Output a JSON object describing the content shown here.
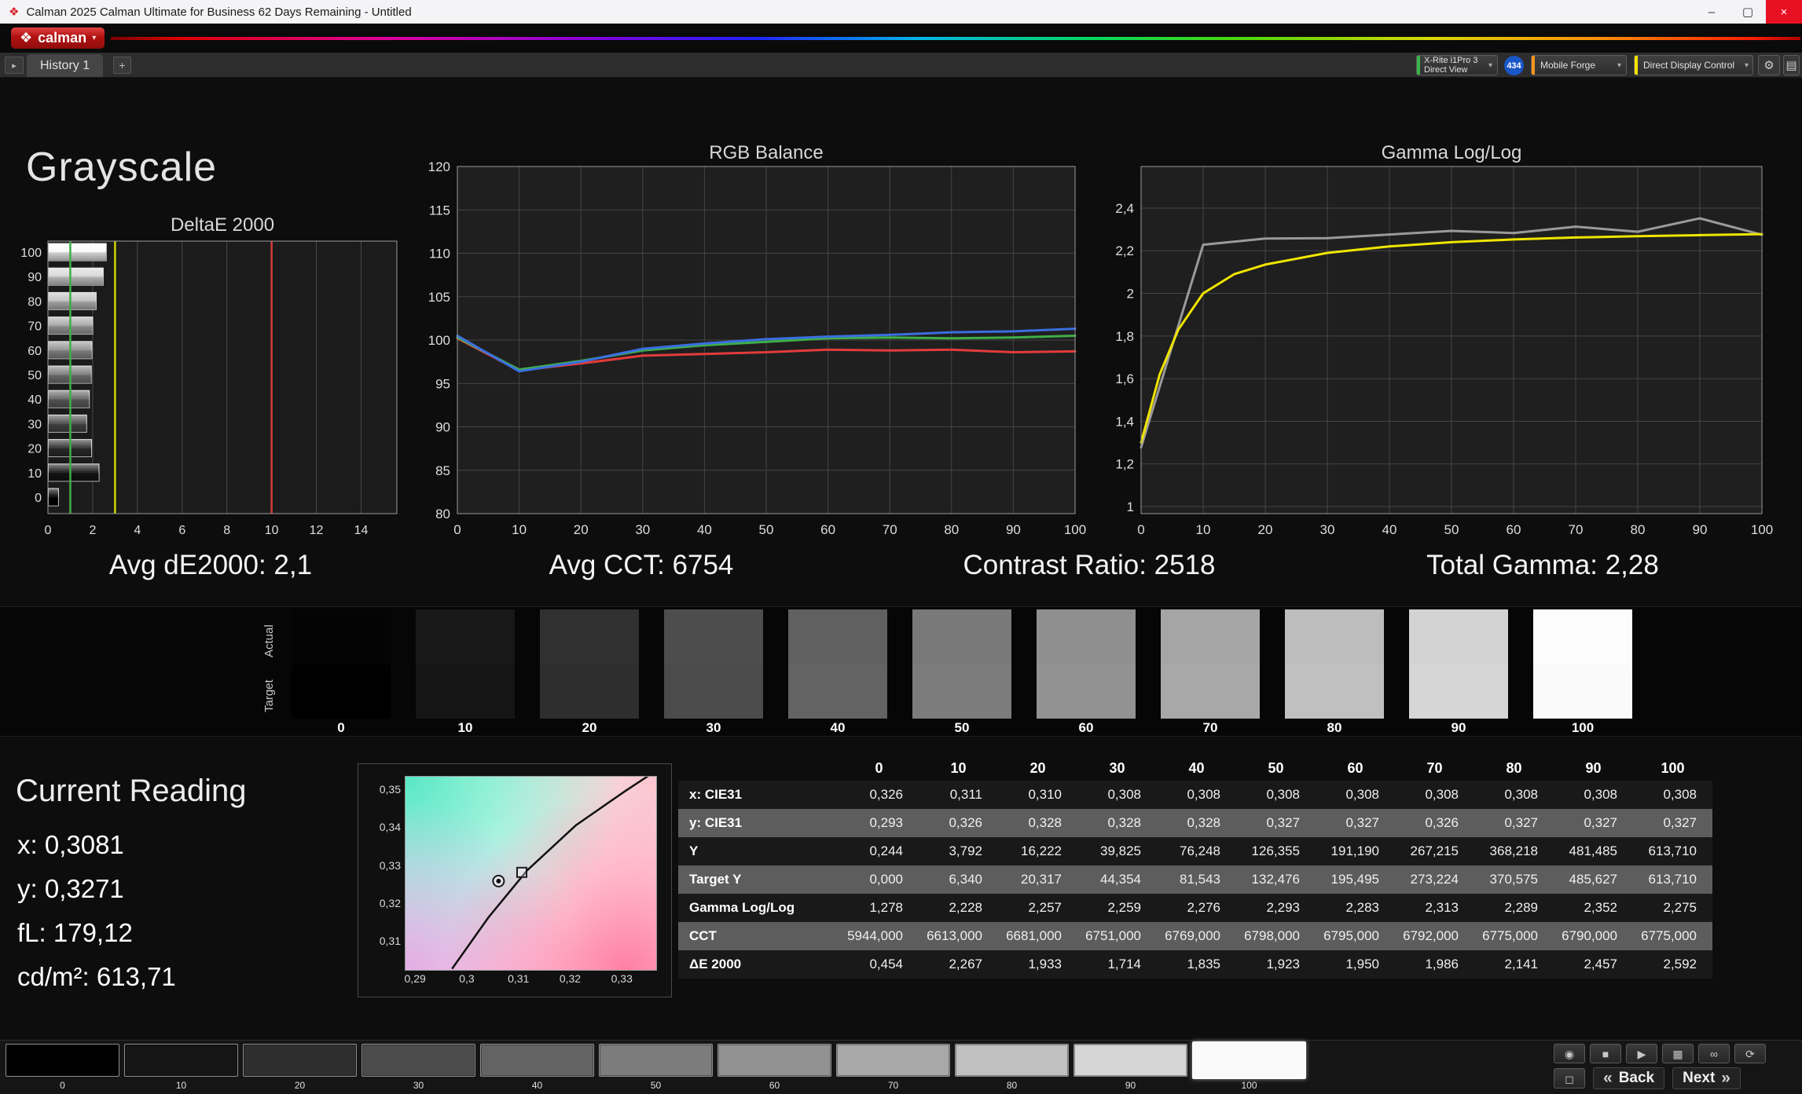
{
  "window": {
    "title": "Calman 2025 Calman Ultimate for Business 62 Days Remaining  - Untitled",
    "app_icon": "❖",
    "minimize_glyph": "–",
    "maximize_glyph": "▢",
    "close_glyph": "×",
    "logo_icon": "❖",
    "logo_text": "calman",
    "logo_caret": "▾"
  },
  "tabbar": {
    "expander_glyph": "▸",
    "history_tab": "History 1",
    "add_glyph": "+"
  },
  "toolbar": {
    "meter_button": {
      "line1": "X-Rite i1Pro 3",
      "line2": "Direct View",
      "accent": "#3cb54a",
      "caret": "▾"
    },
    "badge": "434",
    "badge_color": "#1956c8",
    "source_button": {
      "label": "Mobile Forge",
      "accent": "#f7941d",
      "caret": "▾"
    },
    "display_button": {
      "label": "Direct Display Control",
      "accent": "#f5e400",
      "caret": "▾"
    },
    "gear_glyph": "⚙",
    "panel_glyph": "▤"
  },
  "page": {
    "title": "Grayscale",
    "summaries": [
      "Avg dE2000: 2,1",
      "Avg CCT: 6754",
      "Contrast Ratio: 2518",
      "Total Gamma: 2,28"
    ]
  },
  "chart_data": [
    {
      "type": "bar",
      "title": "DeltaE 2000",
      "orientation": "horizontal",
      "categories": [
        100,
        90,
        80,
        70,
        60,
        50,
        40,
        30,
        20,
        10,
        0
      ],
      "values": [
        2.592,
        2.457,
        2.141,
        1.986,
        1.95,
        1.923,
        1.835,
        1.714,
        1.933,
        2.267,
        0.454
      ],
      "xlim": [
        0,
        15.6
      ],
      "xticks": [
        0,
        2,
        4,
        6,
        8,
        10,
        12,
        14
      ],
      "reference_lines": [
        {
          "name": "good",
          "value": 1,
          "color": "#3fae49"
        },
        {
          "name": "warning",
          "value": 3,
          "color": "#cfd400"
        },
        {
          "name": "bad",
          "value": 10,
          "color": "#d43a3a"
        }
      ]
    },
    {
      "type": "line",
      "title": "RGB Balance",
      "x": [
        0,
        10,
        20,
        30,
        40,
        50,
        60,
        70,
        80,
        90,
        100
      ],
      "ylim": [
        80,
        120
      ],
      "yticks": [
        120,
        115,
        110,
        105,
        100,
        95,
        90,
        85,
        80
      ],
      "xticks": [
        0,
        10,
        20,
        30,
        40,
        50,
        60,
        70,
        80,
        90,
        100
      ],
      "series": [
        {
          "name": "Red",
          "color": "#e23b3b",
          "values": [
            100.2,
            96.5,
            97.3,
            98.2,
            98.4,
            98.6,
            98.9,
            98.8,
            98.9,
            98.6,
            98.7
          ]
        },
        {
          "name": "Green",
          "color": "#3fae49",
          "values": [
            100.3,
            96.6,
            97.6,
            98.8,
            99.4,
            99.8,
            100.2,
            100.3,
            100.2,
            100.3,
            100.5
          ]
        },
        {
          "name": "Blue",
          "color": "#3a6fe0",
          "values": [
            100.5,
            96.4,
            97.5,
            99.0,
            99.6,
            100.1,
            100.4,
            100.6,
            100.9,
            101.0,
            101.3
          ]
        }
      ]
    },
    {
      "type": "line",
      "title": "Gamma Log/Log",
      "ylim": [
        0.967,
        2.595
      ],
      "yticks": [
        {
          "v": 2.4,
          "label": "2,4"
        },
        {
          "v": 2.2,
          "label": "2,2"
        },
        {
          "v": 2.0,
          "label": "2"
        },
        {
          "v": 1.8,
          "label": "1,8"
        },
        {
          "v": 1.6,
          "label": "1,6"
        },
        {
          "v": 1.4,
          "label": "1,4"
        },
        {
          "v": 1.2,
          "label": "1,2"
        },
        {
          "v": 1.0,
          "label": "1"
        }
      ],
      "xticks": [
        0,
        10,
        20,
        30,
        40,
        50,
        60,
        70,
        80,
        90,
        100
      ],
      "series": [
        {
          "name": "Measured",
          "color": "#9a9a9a",
          "x": [
            0,
            10,
            20,
            30,
            40,
            50,
            60,
            70,
            80,
            90,
            100
          ],
          "values": [
            1.278,
            2.228,
            2.257,
            2.259,
            2.276,
            2.293,
            2.283,
            2.313,
            2.289,
            2.352,
            2.275
          ]
        },
        {
          "name": "Gamma trend",
          "color": "#f0e500",
          "x": [
            0,
            3,
            6,
            10,
            15,
            20,
            30,
            40,
            50,
            60,
            70,
            80,
            90,
            100
          ],
          "values": [
            1.3,
            1.62,
            1.83,
            2.0,
            2.09,
            2.135,
            2.19,
            2.22,
            2.24,
            2.253,
            2.262,
            2.268,
            2.273,
            2.278
          ]
        }
      ]
    }
  ],
  "swatches": {
    "row_labels": [
      "Actual",
      "Target"
    ],
    "levels": [
      "0",
      "10",
      "20",
      "30",
      "40",
      "50",
      "60",
      "70",
      "80",
      "90",
      "100"
    ],
    "actual_colors": [
      "#040404",
      "#181818",
      "#303030",
      "#4d4d4d",
      "#606060",
      "#797979",
      "#8f8f8f",
      "#a5a5a5",
      "#bdbdbd",
      "#d3d3d3",
      "#fcfcfc"
    ],
    "target_colors": [
      "#000000",
      "#151515",
      "#2e2e2e",
      "#4b4b4b",
      "#636363",
      "#7c7c7c",
      "#929292",
      "#a8a8a8",
      "#c0c0c0",
      "#d6d6d6",
      "#fafafa"
    ]
  },
  "current_reading": {
    "title": "Current Reading",
    "values": [
      "x: 0,3081",
      "y: 0,3271",
      "fL: 179,12",
      "cd/m²: 613,71"
    ]
  },
  "cie_chart": {
    "xticks": [
      "0,29",
      "0,3",
      "0,31",
      "0,32",
      "0,33"
    ],
    "xtick_values": [
      0.29,
      0.3,
      0.31,
      0.32,
      0.33
    ],
    "yticks": [
      "0,35",
      "0,34",
      "0,33",
      "0,32",
      "0,31"
    ],
    "ytick_values": [
      0.35,
      0.34,
      0.33,
      0.32,
      0.31
    ],
    "xlim": [
      0.288,
      0.3365
    ],
    "ylim": [
      0.3027,
      0.3538
    ],
    "locus": [
      [
        0.297,
        0.303
      ],
      [
        0.304,
        0.3165
      ],
      [
        0.3115,
        0.329
      ],
      [
        0.321,
        0.341
      ],
      [
        0.3305,
        0.35
      ],
      [
        0.3355,
        0.3545
      ]
    ],
    "markers": [
      {
        "shape": "circle",
        "x": 0.306,
        "y": 0.3262
      },
      {
        "shape": "square",
        "x": 0.3105,
        "y": 0.3285
      }
    ]
  },
  "table": {
    "columns": [
      "0",
      "10",
      "20",
      "30",
      "40",
      "50",
      "60",
      "70",
      "80",
      "90",
      "100"
    ],
    "rows": [
      {
        "label": "x: CIE31",
        "shade": "dark",
        "values": [
          "0,326",
          "0,311",
          "0,310",
          "0,308",
          "0,308",
          "0,308",
          "0,308",
          "0,308",
          "0,308",
          "0,308",
          "0,308"
        ]
      },
      {
        "label": "y: CIE31",
        "shade": "light",
        "values": [
          "0,293",
          "0,326",
          "0,328",
          "0,328",
          "0,328",
          "0,327",
          "0,327",
          "0,326",
          "0,327",
          "0,327",
          "0,327"
        ]
      },
      {
        "label": "Y",
        "shade": "dark",
        "values": [
          "0,244",
          "3,792",
          "16,222",
          "39,825",
          "76,248",
          "126,355",
          "191,190",
          "267,215",
          "368,218",
          "481,485",
          "613,710"
        ]
      },
      {
        "label": "Target Y",
        "shade": "light",
        "values": [
          "0,000",
          "6,340",
          "20,317",
          "44,354",
          "81,543",
          "132,476",
          "195,495",
          "273,224",
          "370,575",
          "485,627",
          "613,710"
        ]
      },
      {
        "label": "Gamma Log/Log",
        "shade": "dark",
        "values": [
          "1,278",
          "2,228",
          "2,257",
          "2,259",
          "2,276",
          "2,293",
          "2,283",
          "2,313",
          "2,289",
          "2,352",
          "2,275"
        ]
      },
      {
        "label": "CCT",
        "shade": "light",
        "values": [
          "5944,000",
          "6613,000",
          "6681,000",
          "6751,000",
          "6769,000",
          "6798,000",
          "6795,000",
          "6792,000",
          "6775,000",
          "6790,000",
          "6775,000"
        ]
      },
      {
        "label": "ΔE 2000",
        "shade": "dark",
        "values": [
          "0,454",
          "2,267",
          "1,933",
          "1,714",
          "1,835",
          "1,923",
          "1,950",
          "1,986",
          "2,141",
          "2,457",
          "2,592"
        ]
      }
    ]
  },
  "bottom_bar": {
    "levels": [
      "0",
      "10",
      "20",
      "30",
      "40",
      "50",
      "60",
      "70",
      "80",
      "90",
      "100"
    ],
    "colors": [
      "#000000",
      "#151515",
      "#2e2e2e",
      "#4b4b4b",
      "#636363",
      "#7c7c7c",
      "#929292",
      "#a8a8a8",
      "#c0c0c0",
      "#d6d6d6",
      "#fafafa"
    ],
    "selected_index": 10,
    "transport": [
      {
        "name": "display",
        "glyph": "◉"
      },
      {
        "name": "stop",
        "glyph": "■"
      },
      {
        "name": "play",
        "glyph": "▶"
      },
      {
        "name": "save",
        "glyph": "▦"
      },
      {
        "name": "continuous",
        "glyph": "∞"
      },
      {
        "name": "refresh",
        "glyph": "⟳"
      }
    ],
    "panel_glyph": "◻",
    "back": {
      "icon": "«",
      "label": "Back"
    },
    "next": {
      "label": "Next",
      "icon": "»"
    }
  }
}
